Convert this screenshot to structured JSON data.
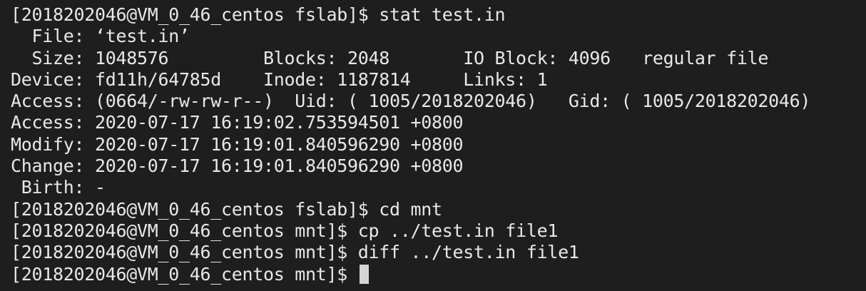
{
  "terminal": {
    "lines": [
      "[2018202046@VM_0_46_centos fslab]$ stat test.in",
      "  File: ‘test.in’",
      "  Size: 1048576         Blocks: 2048       IO Block: 4096   regular file",
      "Device: fd11h/64785d    Inode: 1187814     Links: 1",
      "Access: (0664/-rw-rw-r--)  Uid: ( 1005/2018202046)   Gid: ( 1005/2018202046)",
      "Access: 2020-07-17 16:19:02.753594501 +0800",
      "Modify: 2020-07-17 16:19:01.840596290 +0800",
      "Change: 2020-07-17 16:19:01.840596290 +0800",
      " Birth: -",
      "[2018202046@VM_0_46_centos fslab]$ cd mnt",
      "[2018202046@VM_0_46_centos mnt]$ cp ../test.in file1",
      "[2018202046@VM_0_46_centos mnt]$ diff ../test.in file1"
    ],
    "prompt": "[2018202046@VM_0_46_centos mnt]$ ",
    "colors": {
      "background": "#1e1e1e",
      "foreground": "#e8e8e8",
      "cursor": "#d4d4d4"
    }
  }
}
